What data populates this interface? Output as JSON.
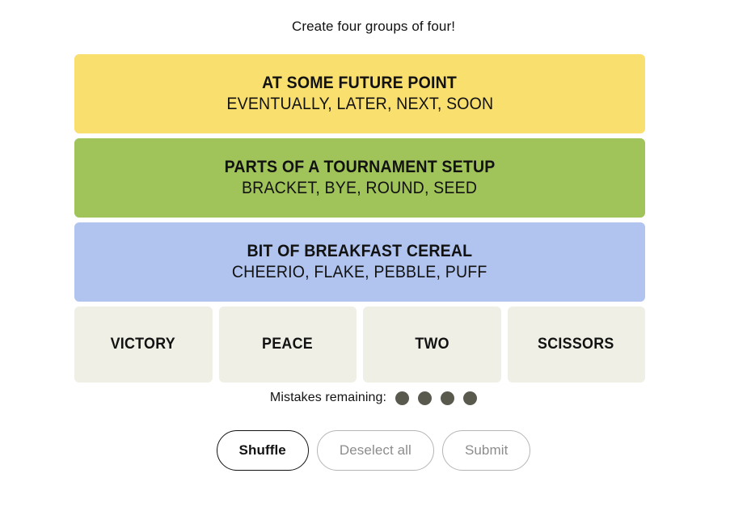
{
  "header": {
    "instruction": "Create four groups of four!"
  },
  "board": {
    "solved_groups": [
      {
        "category": "AT SOME FUTURE POINT",
        "words_text": "EVENTUALLY, LATER, NEXT, SOON",
        "words": [
          "EVENTUALLY",
          "LATER",
          "NEXT",
          "SOON"
        ],
        "color": "#f9df6d",
        "difficulty": "yellow"
      },
      {
        "category": "PARTS OF A TOURNAMENT SETUP",
        "words_text": "BRACKET, BYE, ROUND, SEED",
        "words": [
          "BRACKET",
          "BYE",
          "ROUND",
          "SEED"
        ],
        "color": "#a0c35a",
        "difficulty": "green"
      },
      {
        "category": "BIT OF BREAKFAST CEREAL",
        "words_text": "CHEERIO, FLAKE, PEBBLE, PUFF",
        "words": [
          "CHEERIO",
          "FLAKE",
          "PEBBLE",
          "PUFF"
        ],
        "color": "#b0c4ef",
        "difficulty": "blue"
      }
    ],
    "remaining_tiles": [
      {
        "label": "VICTORY",
        "selected": false
      },
      {
        "label": "PEACE",
        "selected": false
      },
      {
        "label": "TWO",
        "selected": false
      },
      {
        "label": "SCISSORS",
        "selected": false
      }
    ],
    "tile_color": "#efefe6"
  },
  "mistakes": {
    "label": "Mistakes remaining:",
    "count": 4,
    "dot_color": "#5a594e"
  },
  "buttons": [
    {
      "label": "Shuffle",
      "state": "enabled"
    },
    {
      "label": "Deselect all",
      "state": "disabled"
    },
    {
      "label": "Submit",
      "state": "disabled"
    }
  ]
}
